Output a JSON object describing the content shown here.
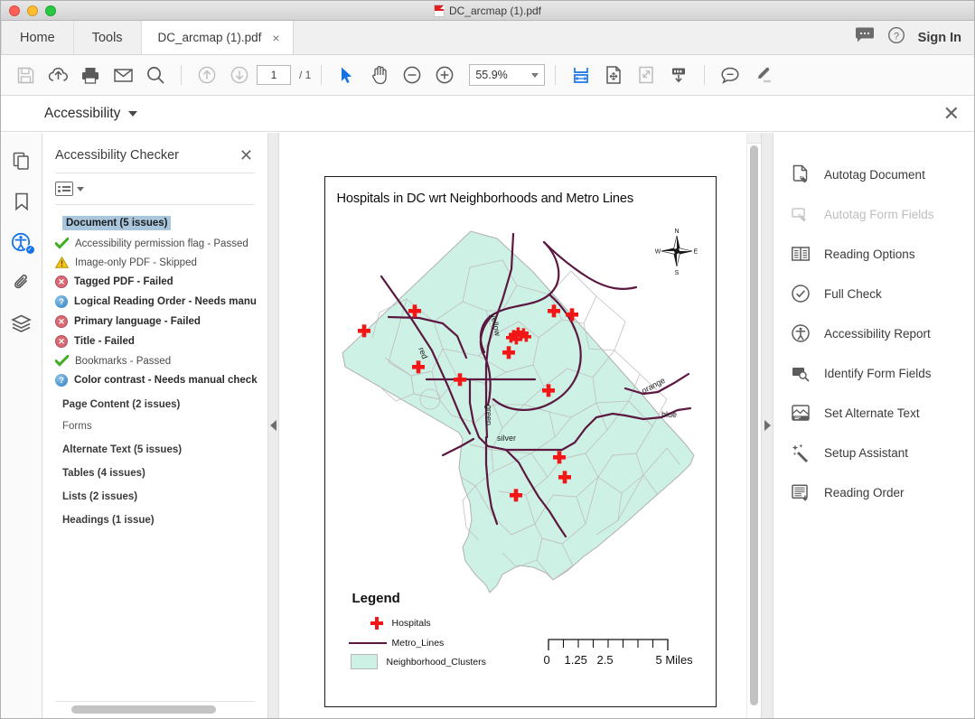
{
  "window": {
    "title": "DC_arcmap (1).pdf"
  },
  "tabbar": {
    "menu": [
      {
        "label": "Home",
        "name": "menu-home"
      },
      {
        "label": "Tools",
        "name": "menu-tools"
      }
    ],
    "document_tab": {
      "label": "DC_arcmap (1).pdf",
      "close": "×"
    },
    "sign_in": "Sign In"
  },
  "toolbar": {
    "page_value": "1",
    "page_total": "/ 1",
    "zoom_value": "55.9%",
    "icons": [
      "save-icon",
      "upload-cloud-icon",
      "print-icon",
      "email-icon",
      "search-icon",
      "previous-page-icon",
      "next-page-icon",
      "select-tool-icon",
      "hand-tool-icon",
      "zoom-out-icon",
      "zoom-in-icon",
      "fit-width-icon",
      "pan-zoom-icon",
      "fullscreen-icon",
      "scroll-down-icon",
      "comment-icon",
      "highlight-icon"
    ]
  },
  "accessibility_header": {
    "title": "Accessibility",
    "close": "✕"
  },
  "left_panel": {
    "title": "Accessibility Checker",
    "close": "✕",
    "items": [
      {
        "label": "Document (5 issues)",
        "status": "group-selected",
        "icon": "none"
      },
      {
        "label": "Accessibility permission flag - Passed",
        "status": "passed",
        "icon": "green-check-icon"
      },
      {
        "label": "Image-only PDF - Skipped",
        "status": "skipped",
        "icon": "warning-triangle-icon"
      },
      {
        "label": "Tagged PDF - Failed",
        "status": "failed",
        "icon": "red-x-circle-icon"
      },
      {
        "label": "Logical Reading Order - Needs manu",
        "status": "manual",
        "icon": "blue-question-icon"
      },
      {
        "label": "Primary language - Failed",
        "status": "failed",
        "icon": "red-x-circle-icon"
      },
      {
        "label": "Title - Failed",
        "status": "failed",
        "icon": "red-x-circle-icon"
      },
      {
        "label": "Bookmarks - Passed",
        "status": "passed",
        "icon": "green-check-icon"
      },
      {
        "label": "Color contrast - Needs manual check",
        "status": "manual",
        "icon": "blue-question-icon"
      },
      {
        "label": "Page Content (2 issues)",
        "status": "group",
        "icon": "none"
      },
      {
        "label": "Forms",
        "status": "group-plain",
        "icon": "none"
      },
      {
        "label": "Alternate Text (5 issues)",
        "status": "group",
        "icon": "none"
      },
      {
        "label": "Tables (4 issues)",
        "status": "group",
        "icon": "none"
      },
      {
        "label": "Lists (2 issues)",
        "status": "group",
        "icon": "none"
      },
      {
        "label": "Headings (1 issue)",
        "status": "group",
        "icon": "none"
      }
    ]
  },
  "rail": [
    {
      "name": "page-thumbnails-icon"
    },
    {
      "name": "bookmarks-icon"
    },
    {
      "name": "accessibility-icon"
    },
    {
      "name": "attachments-icon"
    },
    {
      "name": "layers-icon"
    }
  ],
  "right_panel": {
    "tools": [
      {
        "label": "Autotag Document",
        "icon": "autotag-document-icon",
        "disabled": false
      },
      {
        "label": "Autotag Form Fields",
        "icon": "autotag-form-fields-icon",
        "disabled": true
      },
      {
        "label": "Reading Options",
        "icon": "reading-options-icon",
        "disabled": false
      },
      {
        "label": "Full Check",
        "icon": "full-check-icon",
        "disabled": false
      },
      {
        "label": "Accessibility Report",
        "icon": "accessibility-report-icon",
        "disabled": false
      },
      {
        "label": "Identify Form Fields",
        "icon": "identify-form-fields-icon",
        "disabled": false
      },
      {
        "label": "Set Alternate Text",
        "icon": "set-alternate-text-icon",
        "disabled": false
      },
      {
        "label": "Setup Assistant",
        "icon": "setup-assistant-icon",
        "disabled": false
      },
      {
        "label": "Reading Order",
        "icon": "reading-order-icon",
        "disabled": false
      }
    ]
  },
  "map": {
    "title": "Hospitals in DC wrt Neighborhoods and Metro Lines",
    "legend_title": "Legend",
    "legend_items": [
      {
        "label": "Hospitals",
        "symbol": "red-cross-marker"
      },
      {
        "label": "Metro_Lines",
        "symbol": "purple-line"
      },
      {
        "label": "Neighborhood_Clusters",
        "symbol": "teal-polygon"
      }
    ],
    "compass": {
      "n": "N",
      "e": "E",
      "s": "S",
      "w": "W"
    },
    "metro_line_labels": [
      "red",
      "yellow",
      "green",
      "silver",
      "orange",
      "blue"
    ],
    "scale_bar": {
      "ticks": [
        "0",
        "1.25",
        "2.5",
        "5 Miles"
      ]
    },
    "colors": {
      "neighborhood_fill": "#cdf1e4",
      "metro_line": "#5c1840",
      "hospital_marker": "#f21616",
      "boundary": "#b8b8b8"
    }
  }
}
